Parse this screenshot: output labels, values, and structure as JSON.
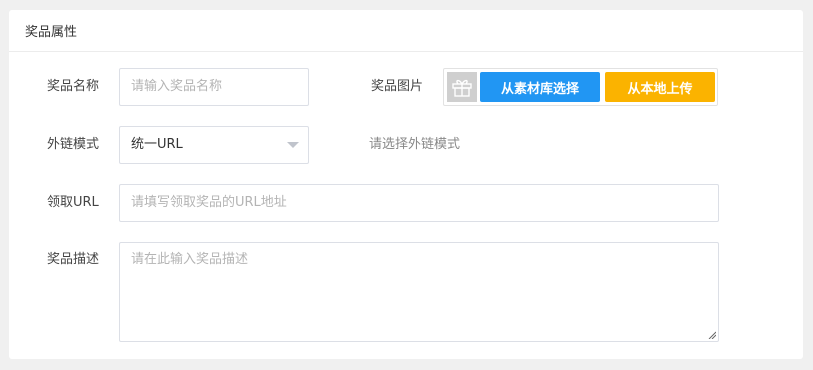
{
  "header": {
    "title": "奖品属性"
  },
  "form": {
    "name": {
      "label": "奖品名称",
      "placeholder": "请输入奖品名称"
    },
    "image": {
      "label": "奖品图片",
      "thumb_icon": "gift-icon",
      "library_button": "从素材库选择",
      "upload_button": "从本地上传",
      "library_color": "#2196f3",
      "upload_color": "#fbb300"
    },
    "link_mode": {
      "label": "外链模式",
      "selected": "统一URL",
      "hint": "请选择外链模式"
    },
    "url": {
      "label": "领取URL",
      "placeholder": "请填写领取奖品的URL地址"
    },
    "description": {
      "label": "奖品描述",
      "placeholder": "请在此输入奖品描述"
    }
  }
}
